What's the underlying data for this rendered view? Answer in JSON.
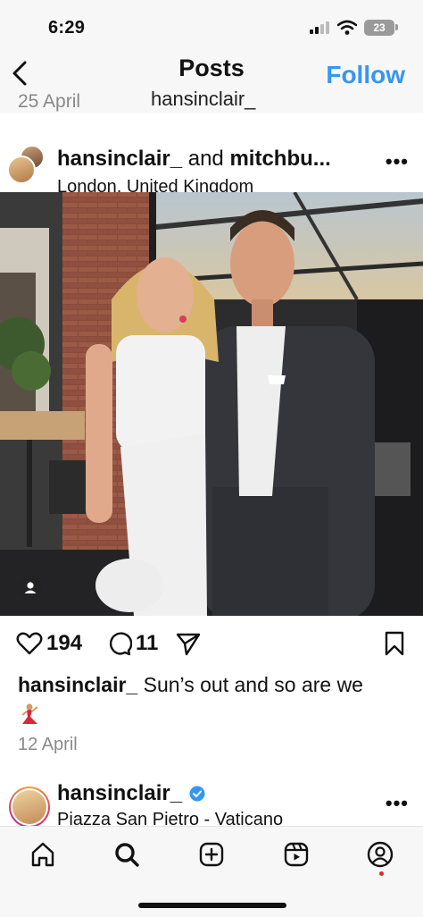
{
  "status_bar": {
    "time": "6:29",
    "battery": "23"
  },
  "header": {
    "title": "Posts",
    "follow_label": "Follow"
  },
  "previous_strip": {
    "date": "25 April",
    "username": "hansinclair_"
  },
  "post": {
    "user": "hansinclair_",
    "joiner": "and",
    "collaborator": "mitchbu...",
    "location": "London, United Kingdom",
    "likes": "194",
    "comments": "11",
    "caption_user": "hansinclair_",
    "caption_text": "Sun’s out and so are we",
    "date": "12 April"
  },
  "next_post": {
    "user": "hansinclair_",
    "location": "Piazza San Pietro - Vaticano"
  },
  "colors": {
    "accent": "#3597f0",
    "notification": "#e5252a"
  }
}
